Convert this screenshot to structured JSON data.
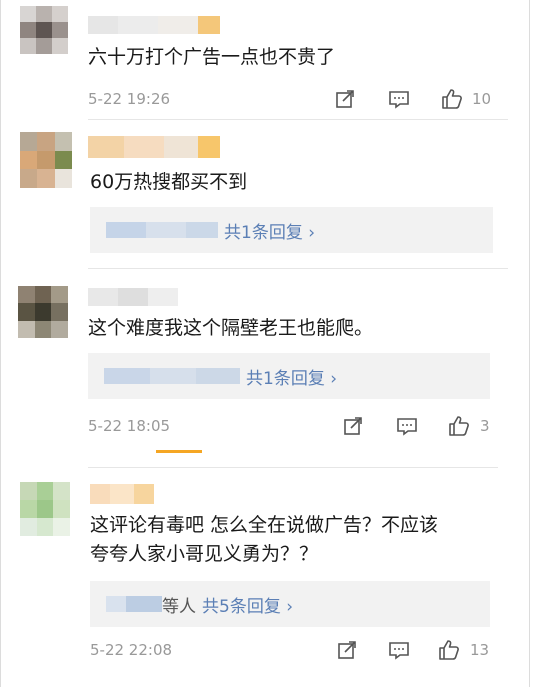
{
  "comments": [
    {
      "text": "六十万打个广告一点也不贵了",
      "time": "5-22 19:26",
      "likes": "10",
      "reply_label": ""
    },
    {
      "text": "60万热搜都买不到",
      "time": "",
      "likes": "",
      "reply_label": "共1条回复 ›"
    },
    {
      "text": "这个难度我这个隔壁老王也能爬。",
      "time": "5-22 18:05",
      "likes": "3",
      "reply_label": "共1条回复 ›"
    },
    {
      "text_line1": "这评论有毒吧 怎么全在说做广告？不应该",
      "text_line2": "夸夸人家小哥见义勇为？？",
      "time": "5-22 22:08",
      "likes": "13",
      "reply_who": "等人",
      "reply_label": "共5条回复 ›"
    }
  ],
  "icons": {
    "share": "share-icon",
    "comment": "comment-icon",
    "like": "like-icon"
  },
  "colors": {
    "link": "#5b7fb5",
    "meta": "#999999",
    "reply_bg": "#f2f2f2",
    "accent": "#f5a623"
  }
}
